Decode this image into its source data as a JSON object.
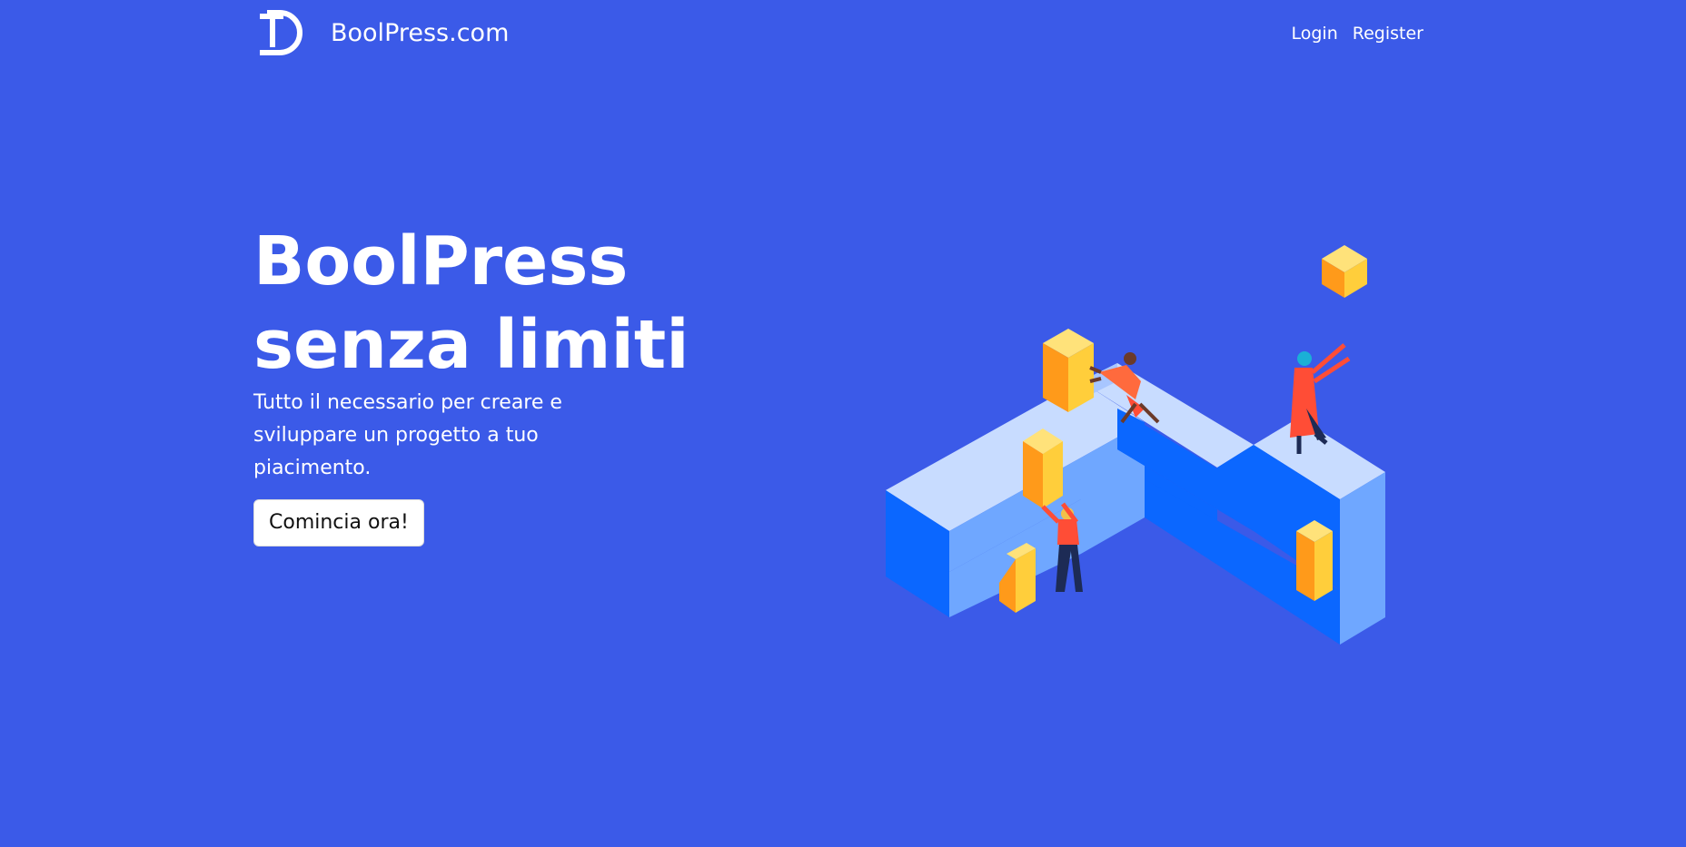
{
  "navbar": {
    "brand_name": "BoolPress.com",
    "logo_icon": "td-logo-icon",
    "links": [
      {
        "label": "Login"
      },
      {
        "label": "Register"
      }
    ]
  },
  "hero": {
    "title": "BoolPress senza limiti",
    "subtitle": "Tutto il necessario per creare e sviluppare un progetto a tuo piacimento.",
    "cta_label": "Comincia ora!"
  },
  "colors": {
    "background": "#3b5ae8",
    "block_top": "#c8dcff",
    "block_side_dark": "#0b67ff",
    "block_side_light": "#6fa7ff",
    "cube_yellow": "#ffce3b",
    "cube_orange": "#ff9a1a",
    "figure_red": "#ff4d36"
  }
}
